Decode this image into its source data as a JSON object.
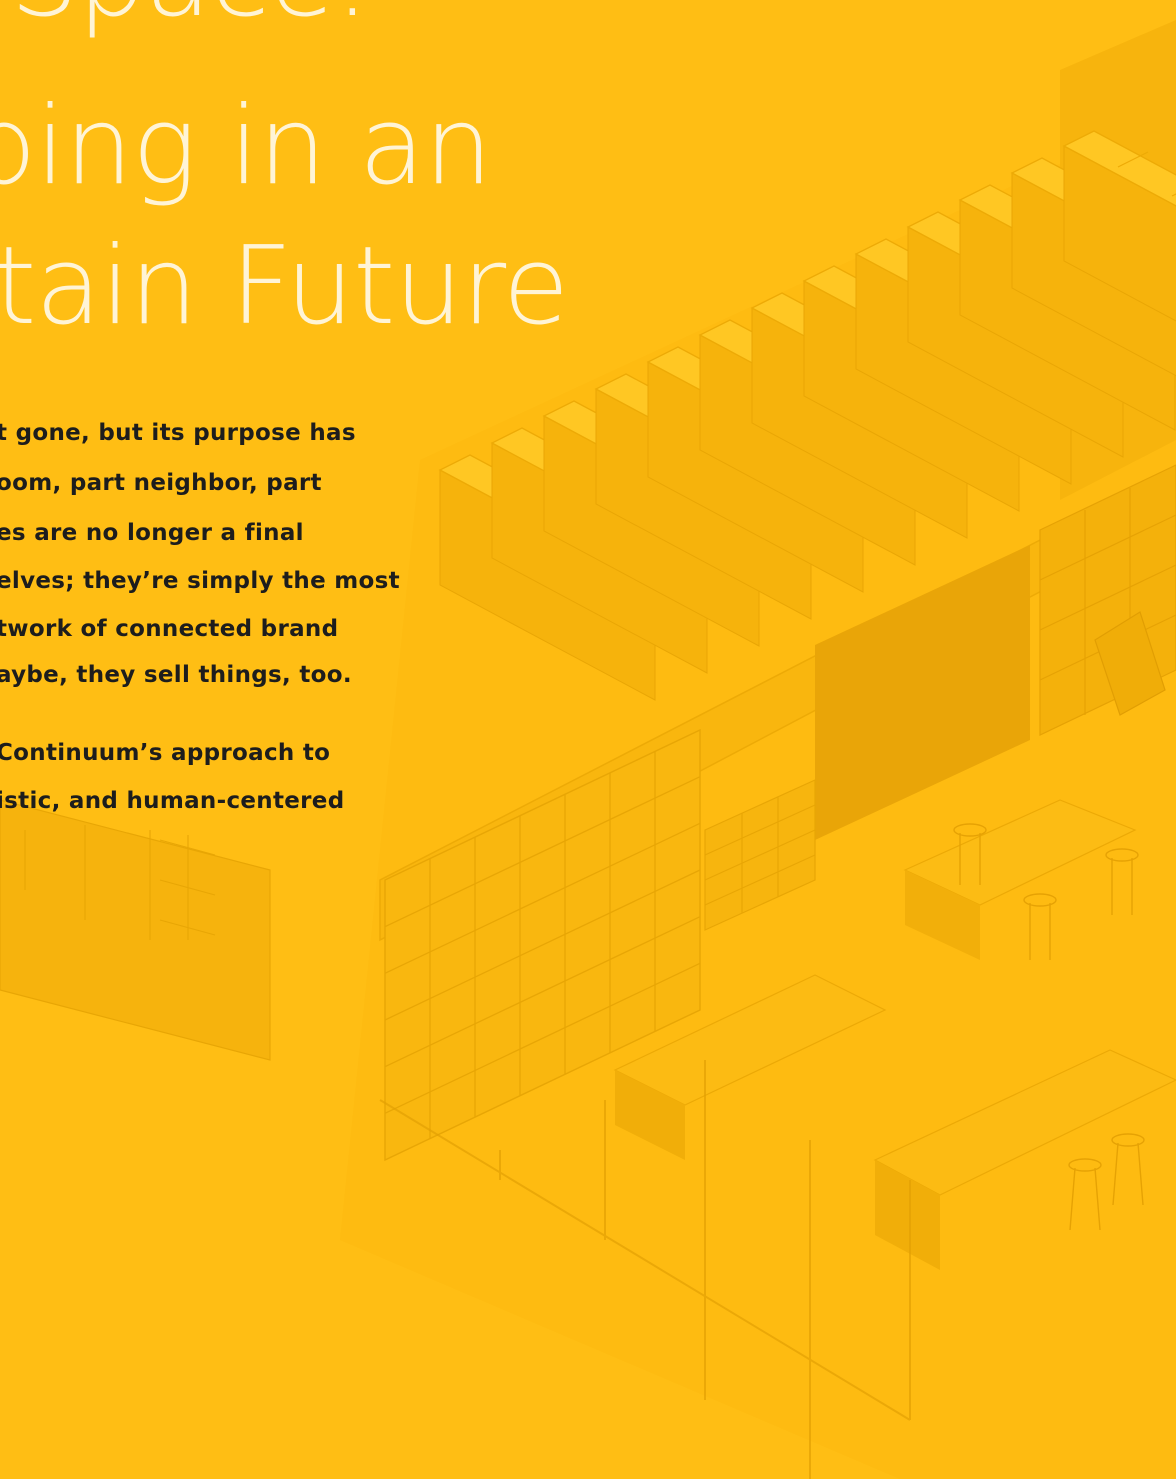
{
  "title": {
    "lines": [
      "Space:",
      "ping in an",
      "tain Future"
    ]
  },
  "body": {
    "paragraph_1": [
      "t gone, but its purpose has",
      "oom, part neighbor, part",
      "es are no longer a final",
      "elves; they’re simply the most",
      "twork of connected brand",
      "aybe, they sell things, too."
    ],
    "paragraph_2": [
      "Continuum’s approach to",
      "istic, and human-centered"
    ]
  },
  "colors": {
    "background": "#FFBE14",
    "title": "#FFF4D6",
    "body_text": "#1D1D1D"
  }
}
